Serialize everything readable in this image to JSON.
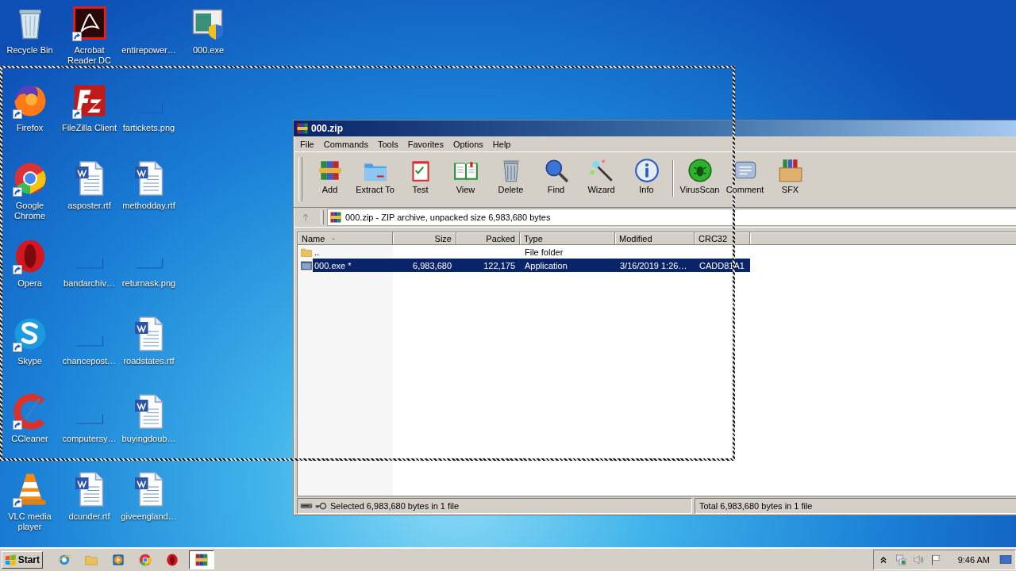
{
  "desktop": {
    "icons": [
      {
        "label": "Recycle Bin",
        "kind": "recycle",
        "shortcut": false
      },
      {
        "label": "Firefox",
        "kind": "firefox",
        "shortcut": true
      },
      {
        "label": "Google Chrome",
        "kind": "chrome",
        "shortcut": true
      },
      {
        "label": "Opera",
        "kind": "opera",
        "shortcut": true
      },
      {
        "label": "Skype",
        "kind": "skype",
        "shortcut": true
      },
      {
        "label": "CCleaner",
        "kind": "ccleaner",
        "shortcut": true
      },
      {
        "label": "VLC media player",
        "kind": "vlc",
        "shortcut": true
      },
      {
        "label": "Acrobat Reader DC",
        "kind": "acrobat",
        "shortcut": true
      },
      {
        "label": "FileZilla Client",
        "kind": "filezilla",
        "shortcut": true
      },
      {
        "label": "asposter.rtf",
        "kind": "word",
        "shortcut": false
      },
      {
        "label": "bandarchiv…",
        "kind": "blank",
        "shortcut": false
      },
      {
        "label": "chancepost…",
        "kind": "blank",
        "shortcut": false
      },
      {
        "label": "computersy…",
        "kind": "blank",
        "shortcut": false
      },
      {
        "label": "dcunder.rtf",
        "kind": "word",
        "shortcut": false
      },
      {
        "label": "entirepower…",
        "kind": "blank",
        "shortcut": false
      },
      {
        "label": "fartickets.png",
        "kind": "blank",
        "shortcut": false
      },
      {
        "label": "methodday.rtf",
        "kind": "word",
        "shortcut": false
      },
      {
        "label": "returnask.png",
        "kind": "blank",
        "shortcut": false
      },
      {
        "label": "roadstates.rtf",
        "kind": "word",
        "shortcut": false
      },
      {
        "label": "buyingdoub…",
        "kind": "word",
        "shortcut": false
      },
      {
        "label": "giveengland…",
        "kind": "word",
        "shortcut": false
      },
      {
        "label": "000.exe",
        "kind": "exe",
        "shortcut": false
      }
    ]
  },
  "window": {
    "title": "000.zip",
    "menu": [
      "File",
      "Commands",
      "Tools",
      "Favorites",
      "Options",
      "Help"
    ],
    "toolbar": {
      "groups": [
        [
          {
            "label": "Add",
            "kind": "add"
          },
          {
            "label": "Extract To",
            "kind": "extract"
          },
          {
            "label": "Test",
            "kind": "test"
          },
          {
            "label": "View",
            "kind": "view"
          },
          {
            "label": "Delete",
            "kind": "delete"
          },
          {
            "label": "Find",
            "kind": "find"
          },
          {
            "label": "Wizard",
            "kind": "wizard"
          },
          {
            "label": "Info",
            "kind": "info"
          }
        ],
        [
          {
            "label": "VirusScan",
            "kind": "virus"
          },
          {
            "label": "Comment",
            "kind": "comment"
          },
          {
            "label": "SFX",
            "kind": "sfx"
          }
        ]
      ]
    },
    "address": "000.zip - ZIP archive, unpacked size 6,983,680 bytes",
    "file_list": {
      "columns": [
        {
          "label": "Name",
          "sorted": true
        },
        {
          "label": "Size",
          "sorted": false
        },
        {
          "label": "Packed",
          "sorted": false
        },
        {
          "label": "Type",
          "sorted": false
        },
        {
          "label": "Modified",
          "sorted": false
        },
        {
          "label": "CRC32",
          "sorted": false
        }
      ],
      "rows": [
        {
          "kind": "folder",
          "name": "..",
          "type": "File folder",
          "selected": false
        },
        {
          "kind": "exe",
          "name": "000.exe *",
          "size": "6,983,680",
          "packed": "122,175",
          "type": "Application",
          "modified": "3/16/2019 1:26…",
          "crc32": "CADD81A1",
          "selected": true
        }
      ]
    },
    "status_bar": {
      "selected_info": "Selected 6,983,680 bytes in 1 file",
      "total_info": "Total 6,983,680 bytes in 1 file"
    }
  },
  "drag_outline": true,
  "taskbar": {
    "start": "Start",
    "apps": [
      {
        "kind": "ie",
        "active": false
      },
      {
        "kind": "folder",
        "active": false
      },
      {
        "kind": "media",
        "active": false
      },
      {
        "kind": "chrome",
        "active": false
      },
      {
        "kind": "opera",
        "active": false
      },
      {
        "kind": "rar",
        "active": true
      }
    ],
    "tray": [
      {
        "kind": "caret"
      },
      {
        "kind": "network"
      },
      {
        "kind": "speaker"
      },
      {
        "kind": "flag"
      }
    ],
    "clock": "9:46 AM"
  }
}
